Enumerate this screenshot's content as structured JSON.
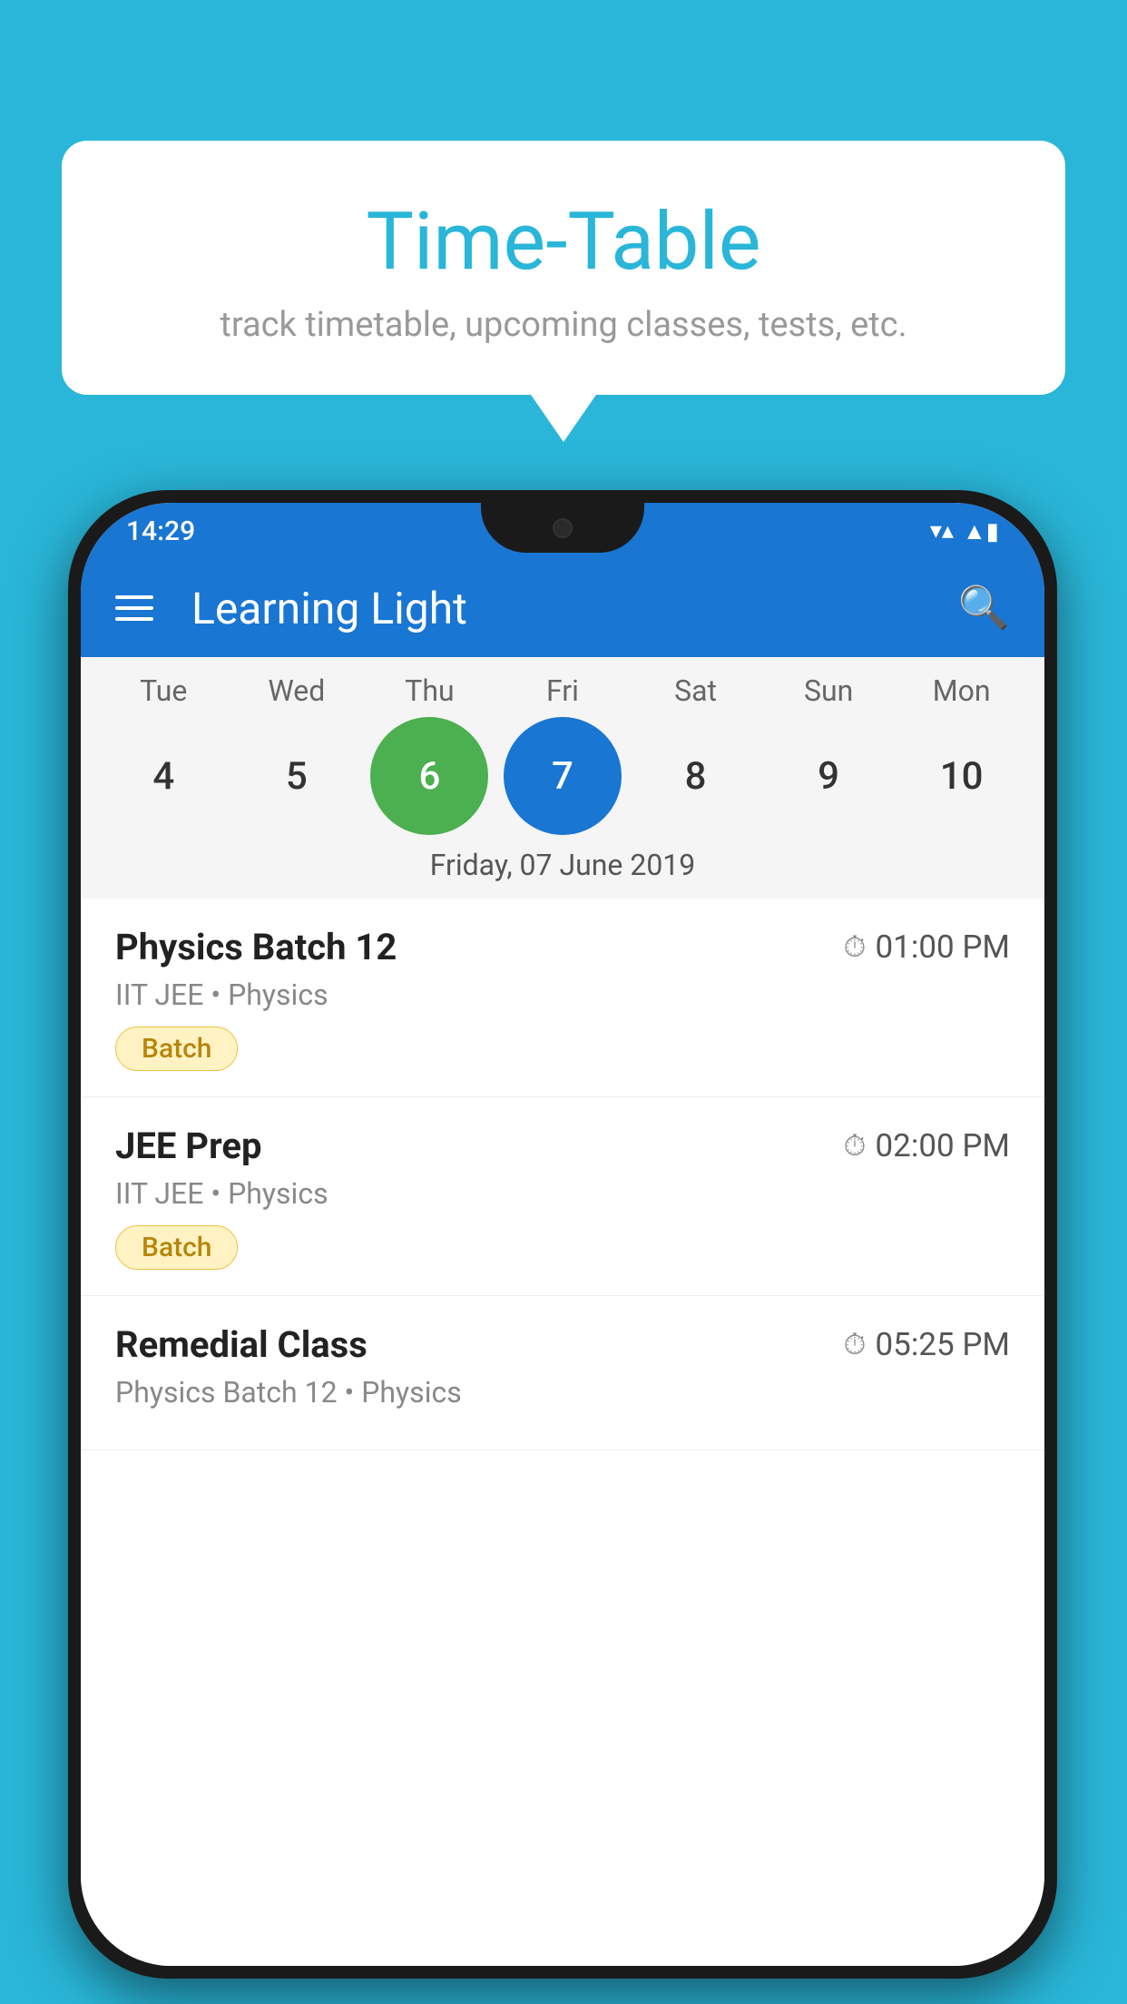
{
  "background_color": "#29B6D8",
  "speech_bubble": {
    "title": "Time-Table",
    "subtitle": "track timetable, upcoming classes, tests, etc."
  },
  "phone": {
    "status_bar": {
      "time": "14:29",
      "wifi_icon": "▼",
      "signal_icon": "▲",
      "battery_icon": "▮"
    },
    "app_bar": {
      "title": "Learning Light",
      "menu_icon": "menu",
      "search_icon": "search"
    },
    "calendar": {
      "days": [
        {
          "label": "Tue",
          "number": "4",
          "state": "normal"
        },
        {
          "label": "Wed",
          "number": "5",
          "state": "normal"
        },
        {
          "label": "Thu",
          "number": "6",
          "state": "today"
        },
        {
          "label": "Fri",
          "number": "7",
          "state": "selected"
        },
        {
          "label": "Sat",
          "number": "8",
          "state": "normal"
        },
        {
          "label": "Sun",
          "number": "9",
          "state": "normal"
        },
        {
          "label": "Mon",
          "number": "10",
          "state": "normal"
        }
      ],
      "selected_date_label": "Friday, 07 June 2019"
    },
    "classes": [
      {
        "name": "Physics Batch 12",
        "time": "01:00 PM",
        "meta": "IIT JEE • Physics",
        "tag": "Batch"
      },
      {
        "name": "JEE Prep",
        "time": "02:00 PM",
        "meta": "IIT JEE • Physics",
        "tag": "Batch"
      },
      {
        "name": "Remedial Class",
        "time": "05:25 PM",
        "meta": "Physics Batch 12 • Physics",
        "tag": ""
      }
    ]
  }
}
